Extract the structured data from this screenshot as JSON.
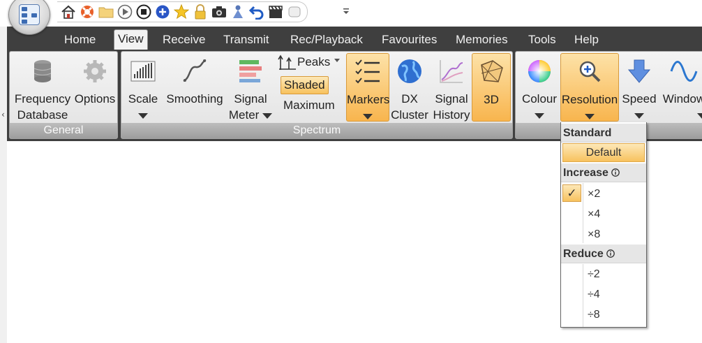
{
  "quick_access": {
    "icons": [
      "home-icon",
      "lifebuoy-icon",
      "folder-icon",
      "play-icon",
      "stop-icon",
      "plus-circle-icon",
      "star-icon",
      "lock-icon",
      "camera-icon",
      "person-icon",
      "undo-icon",
      "clapper-icon",
      "record-icon"
    ]
  },
  "tabs": [
    "Home",
    "View",
    "Receive",
    "Transmit",
    "Rec/Playback",
    "Favourites",
    "Memories",
    "Tools",
    "Help"
  ],
  "active_tab": "View",
  "ribbon": {
    "general": {
      "title": "General",
      "frequency_database": [
        "Frequency",
        "Database"
      ],
      "options": "Options"
    },
    "spectrum": {
      "title": "Spectrum",
      "scale": "Scale",
      "smoothing": "Smoothing",
      "signal_meter": [
        "Signal",
        "Meter"
      ],
      "peaks": "Peaks",
      "shaded": "Shaded",
      "maximum": "Maximum",
      "markers": "Markers",
      "dx_cluster": [
        "DX",
        "Cluster"
      ],
      "signal_history": [
        "Signal",
        "History"
      ],
      "threed": "3D"
    },
    "display": {
      "colour": "Colour",
      "resolution": "Resolution",
      "speed": "Speed",
      "window": "Window"
    }
  },
  "resolution_menu": {
    "standard_header": "Standard",
    "default_item": "Default",
    "increase_header": "Increase",
    "increase_items": [
      "×2",
      "×4",
      "×8"
    ],
    "checked_item": "×2",
    "reduce_header": "Reduce",
    "reduce_items": [
      "÷2",
      "÷4",
      "÷8"
    ],
    "check_mark": "✓"
  },
  "colors": {
    "ribbon_dark": "#3f3f3f",
    "highlight_top": "#fde2a8",
    "highlight_bottom": "#f8b54e",
    "group_title": "#a8a8a8"
  }
}
